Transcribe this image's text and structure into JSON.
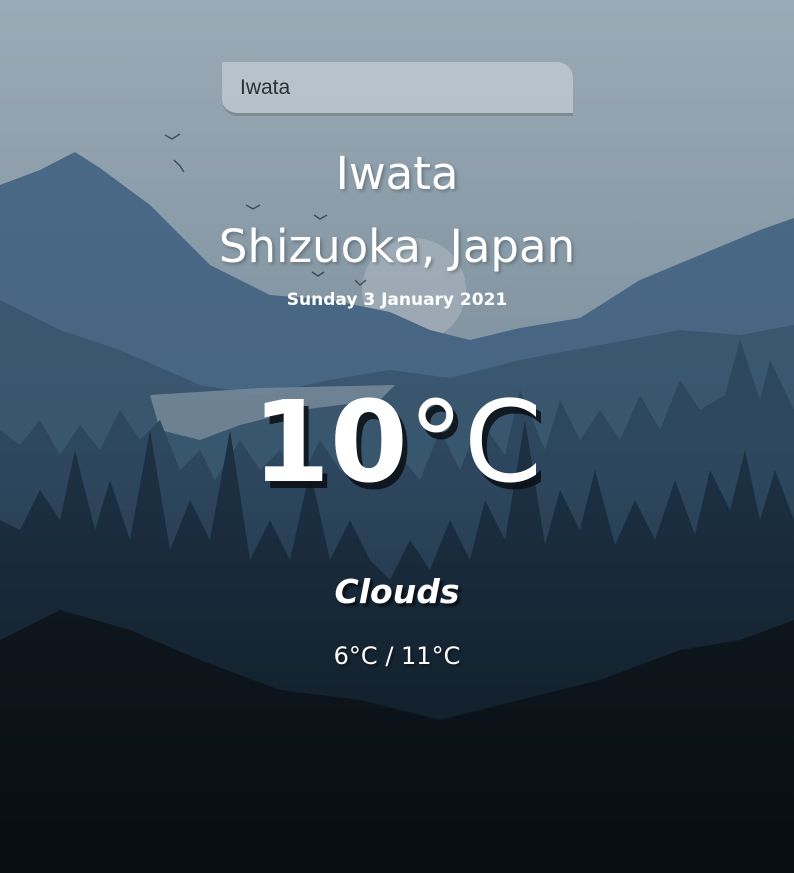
{
  "search": {
    "value": "Iwata"
  },
  "location": {
    "city": "Iwata",
    "region": "Shizuoka, Japan"
  },
  "date": "Sunday 3 January 2021",
  "weather": {
    "temperature": "10",
    "unit": "°C",
    "condition": "Clouds",
    "min_max": "6°C / 11°C"
  },
  "colors": {
    "sky_top": "#99aab5",
    "mountains": "#3f6180",
    "forest": "#1e3345",
    "foreground": "#0b1016"
  }
}
